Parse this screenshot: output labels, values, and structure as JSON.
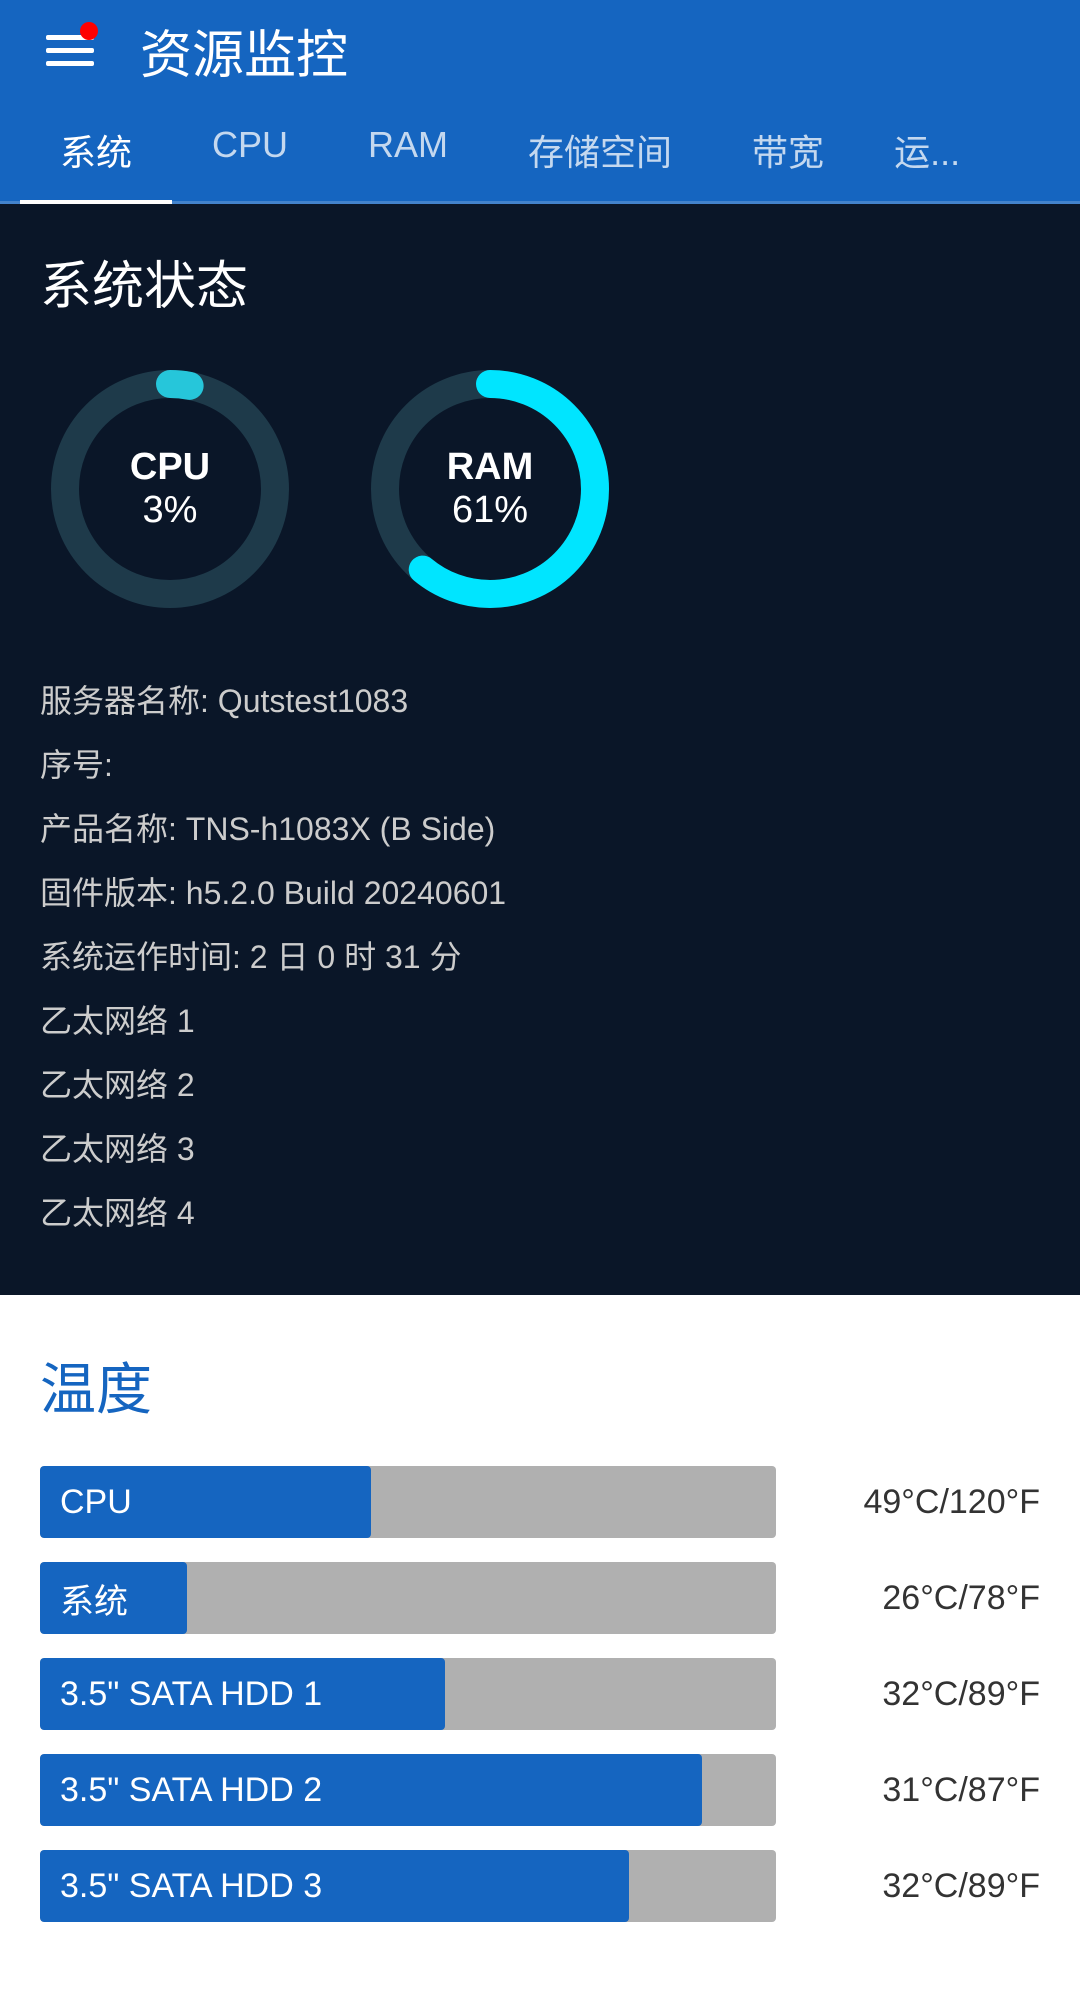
{
  "header": {
    "title": "资源监控"
  },
  "tabs": [
    {
      "label": "系统",
      "active": true
    },
    {
      "label": "CPU",
      "active": false
    },
    {
      "label": "RAM",
      "active": false
    },
    {
      "label": "存储空间",
      "active": false
    },
    {
      "label": "带宽",
      "active": false
    },
    {
      "label": "运...",
      "active": false
    }
  ],
  "system_status": {
    "title": "系统状态",
    "cpu": {
      "name": "CPU",
      "value": "3%",
      "percent": 3,
      "color": "#26c6da"
    },
    "ram": {
      "name": "RAM",
      "value": "61%",
      "percent": 61,
      "color": "#00e5ff"
    }
  },
  "system_info": {
    "server_name_label": "服务器名称:",
    "server_name_value": "Qutstest1083",
    "serial_label": "序号:",
    "serial_value": "",
    "product_label": "产品名称:",
    "product_value": "TNS-h1083X (B Side)",
    "firmware_label": "固件版本:",
    "firmware_value": "h5.2.0 Build 20240601",
    "uptime_label": "系统运作时间:",
    "uptime_value": "2 日 0 时 31 分",
    "networks": [
      "乙太网络 1",
      "乙太网络 2",
      "乙太网络 3",
      "乙太网络 4"
    ]
  },
  "temperature": {
    "title": "温度",
    "items": [
      {
        "label": "CPU",
        "value": "49°C/120°F",
        "fill_percent": 45,
        "fill_color": "#1565C0"
      },
      {
        "label": "系统",
        "value": "26°C/78°F",
        "fill_percent": 20,
        "fill_color": "#1565C0"
      },
      {
        "label": "3.5\" SATA HDD 1",
        "value": "32°C/89°F",
        "fill_percent": 55,
        "fill_color": "#1565C0"
      },
      {
        "label": "3.5\" SATA HDD 2",
        "value": "31°C/87°F",
        "fill_percent": 90,
        "fill_color": "#1565C0"
      },
      {
        "label": "3.5\" SATA HDD 3",
        "value": "32°C/89°F",
        "fill_percent": 80,
        "fill_color": "#1565C0"
      }
    ]
  }
}
